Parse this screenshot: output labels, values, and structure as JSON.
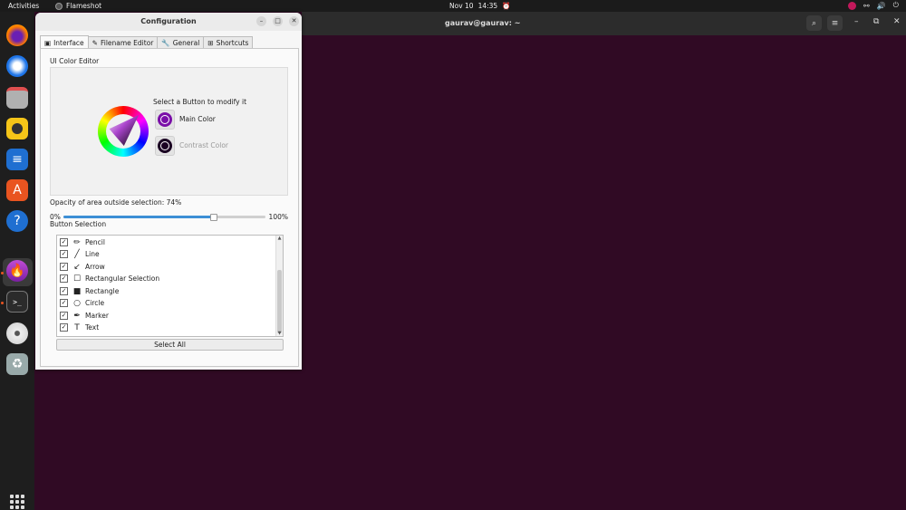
{
  "topbar": {
    "activities": "Activities",
    "app_name": "Flameshot",
    "date": "Nov 10",
    "time": "14:35"
  },
  "terminal": {
    "title": "gaurav@gaurav: ~"
  },
  "window": {
    "title": "Configuration",
    "tabs": [
      {
        "label": "Interface",
        "icon": "interface-icon"
      },
      {
        "label": "Filename Editor",
        "icon": "pen-icon"
      },
      {
        "label": "General",
        "icon": "wrench-icon"
      },
      {
        "label": "Shortcuts",
        "icon": "grid-icon"
      }
    ],
    "color_editor": {
      "label": "UI Color Editor",
      "select_hint": "Select a Button to modify it",
      "main_color_label": "Main Color",
      "main_color": "#7a0fa8",
      "contrast_color_label": "Contrast Color",
      "contrast_color": "#1a0022"
    },
    "opacity": {
      "label": "Opacity of area outside selection: 74%",
      "value": 74,
      "min_label": "0%",
      "max_label": "100%"
    },
    "button_selection": {
      "label": "Button Selection",
      "items": [
        {
          "label": "Pencil",
          "checked": true,
          "icon": "pencil-icon"
        },
        {
          "label": "Line",
          "checked": true,
          "icon": "line-icon"
        },
        {
          "label": "Arrow",
          "checked": true,
          "icon": "arrow-icon"
        },
        {
          "label": "Rectangular Selection",
          "checked": true,
          "icon": "rect-selection-icon"
        },
        {
          "label": "Rectangle",
          "checked": true,
          "icon": "rectangle-icon"
        },
        {
          "label": "Circle",
          "checked": true,
          "icon": "circle-icon"
        },
        {
          "label": "Marker",
          "checked": true,
          "icon": "marker-icon"
        },
        {
          "label": "Text",
          "checked": true,
          "icon": "text-icon"
        }
      ],
      "select_all": "Select All"
    }
  },
  "colors": {
    "desktop": "#300a24",
    "accent": "#3d8fd5"
  }
}
